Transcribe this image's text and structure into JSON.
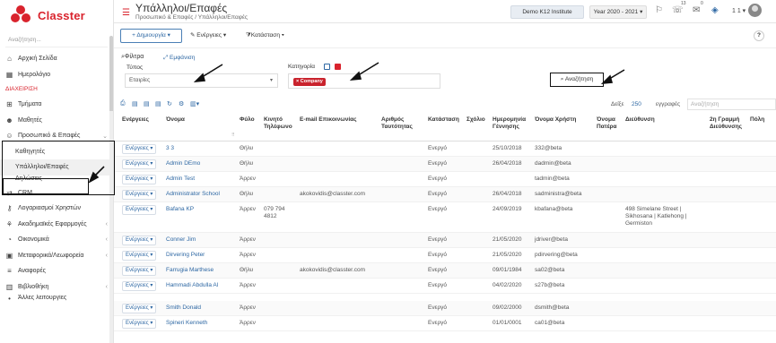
{
  "app": {
    "name": "Classter"
  },
  "sidebar": {
    "search_placeholder": "Αναζήτηση...",
    "items": [
      {
        "label": "Αρχική Σελίδα",
        "icon": "home-icon"
      },
      {
        "label": "Ημερολόγιο",
        "icon": "calendar-icon"
      }
    ],
    "section": "ΔΙΑΧΕΙΡΙΣΗ",
    "admin_items": [
      {
        "label": "Τμήματα",
        "icon": "sitemap-icon"
      },
      {
        "label": "Μαθητές",
        "icon": "students-icon"
      },
      {
        "label": "Προσωπικό & Επαφές",
        "icon": "staff-icon"
      },
      {
        "label": "Καθηγητές",
        "icon": ""
      },
      {
        "label": "Υπάλληλοι/Επαφές",
        "icon": ""
      },
      {
        "label": "Δηλώσεις",
        "icon": ""
      },
      {
        "label": "CRM",
        "icon": "crm-icon"
      },
      {
        "label": "Λογαριασμοί Χρηστών",
        "icon": "key-icon"
      },
      {
        "label": "Ακαδημαϊκές Εφαρμογές",
        "icon": "academic-icon"
      },
      {
        "label": "Οικονομικά",
        "icon": "finance-icon"
      },
      {
        "label": "Μεταφορικά/Λεωφορεία",
        "icon": "bus-icon"
      },
      {
        "label": "Αναφορές",
        "icon": "reports-icon"
      },
      {
        "label": "Βιβλιοθήκη",
        "icon": "library-icon"
      },
      {
        "label": "Άλλες λειτουργίες",
        "icon": "more-icon"
      }
    ]
  },
  "header": {
    "title": "Υπάλληλοι/Επαφές",
    "breadcrumb": "Προσωπικό & Επαφές  /  Υπάλληλοι/Επαφές",
    "institute": "Demo K12 Institute",
    "year": "Year 2020 - 2021 ▾",
    "notif_count": "13",
    "mail_count": "0",
    "user_number": "1 1 ▾"
  },
  "toolbar": {
    "create": "+ Δημιουργία ▾",
    "actions": "Ενέργειες ▾",
    "status": "Κατάσταση ▾",
    "help": "?"
  },
  "filters": {
    "title": "Φίλτρα",
    "toggle": "Εμφάνιση",
    "type_label": "Τύπος",
    "type_value": "Εταιρίες",
    "category_label": "Κατηγορία",
    "chip": "× Company",
    "search_button": "Αναζήτηση"
  },
  "grid": {
    "show_label": "Δείξε",
    "show_count": "250",
    "records_label": "εγγραφές",
    "search_placeholder": "Αναζήτηση",
    "columns": [
      "Ενέργειες",
      "Όνομα",
      "Φύλο",
      "Κινητό Τηλέφωνο",
      "E-mail Επικοινωνίας",
      "Αριθμός Ταυτότητας",
      "Κατάσταση",
      "Σχόλιο",
      "Ημερομηνία Γέννησης",
      "Όνομα Χρήστη",
      "Όνομα Πατέρα",
      "Διεύθυνση",
      "2η Γραμμή Διεύθυνσης",
      "Πόλη"
    ],
    "action_label": "Ενέργειες ▾",
    "rows": [
      {
        "name": "3 3",
        "gender": "Θήλυ",
        "mobile": "",
        "email": "",
        "status": "Ενεργό",
        "dob": "25/10/2018",
        "username": "332@beta",
        "address": ""
      },
      {
        "name": "Admin DEmo",
        "gender": "Θήλυ",
        "mobile": "",
        "email": "",
        "status": "Ενεργό",
        "dob": "26/04/2018",
        "username": "dadmin@beta",
        "address": ""
      },
      {
        "name": "Admin Test",
        "gender": "Άρρεν",
        "mobile": "",
        "email": "",
        "status": "Ενεργό",
        "dob": "",
        "username": "tadmin@beta",
        "address": ""
      },
      {
        "name": "Administrator School",
        "gender": "Θήλυ",
        "mobile": "",
        "email": "akokovidis@classter.com",
        "status": "Ενεργό",
        "dob": "26/04/2018",
        "username": "sadministra@beta",
        "address": ""
      },
      {
        "name": "Bafana KP",
        "gender": "Άρρεν",
        "mobile": "079 794 4812",
        "email": "",
        "status": "Ενεργό",
        "dob": "24/09/2019",
        "username": "kbafana@beta",
        "address": "498 Simelane Street | Sikhosana | Katlehong | Germiston"
      },
      {
        "name": "Conner Jim",
        "gender": "Άρρεν",
        "mobile": "",
        "email": "",
        "status": "Ενεργό",
        "dob": "21/05/2020",
        "username": "jdriver@beta",
        "address": ""
      },
      {
        "name": "Dirvering Peter",
        "gender": "Άρρεν",
        "mobile": "",
        "email": "",
        "status": "Ενεργό",
        "dob": "21/05/2020",
        "username": "pdirvering@beta",
        "address": ""
      },
      {
        "name": "Farrugia Marthese",
        "gender": "Θήλυ",
        "mobile": "",
        "email": "akokovidis@classter.com",
        "status": "Ενεργό",
        "dob": "09/01/1984",
        "username": "sa02@beta",
        "address": ""
      },
      {
        "name": "Hammadi Abdulla Al",
        "gender": "Άρρεν",
        "mobile": "",
        "email": "",
        "status": "Ενεργό",
        "dob": "04/02/2020",
        "username": "s27b@beta",
        "address": ""
      },
      {
        "name": "Smith Donald",
        "gender": "Άρρεν",
        "mobile": "",
        "email": "",
        "status": "Ενεργό",
        "dob": "09/02/2000",
        "username": "dsmith@beta",
        "address": ""
      },
      {
        "name": "Spineri Kenneth",
        "gender": "Άρρεν",
        "mobile": "",
        "email": "",
        "status": "Ενεργό",
        "dob": "01/01/0001",
        "username": "ca01@beta",
        "address": ""
      }
    ]
  }
}
